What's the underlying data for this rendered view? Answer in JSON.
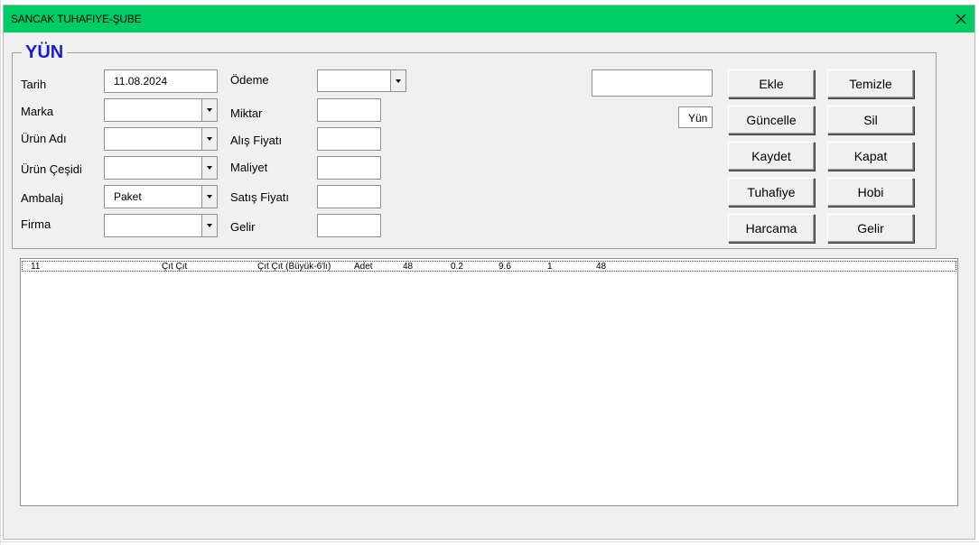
{
  "window": {
    "title": "SANCAK TUHAFIYE-ŞUBE"
  },
  "frame": {
    "caption": "YÜN"
  },
  "fields": {
    "tarih": {
      "label": "Tarih",
      "value": "11.08.2024"
    },
    "marka": {
      "label": "Marka",
      "value": ""
    },
    "urun_adi": {
      "label": "Ürün Adı",
      "value": ""
    },
    "urun_cesidi": {
      "label": "Ürün Çeşidi",
      "value": ""
    },
    "ambalaj": {
      "label": "Ambalaj",
      "value": "Paket"
    },
    "firma": {
      "label": "Firma",
      "value": ""
    },
    "odeme": {
      "label": "Ödeme",
      "value": ""
    },
    "miktar": {
      "label": "Miktar",
      "value": ""
    },
    "alis_fiyati": {
      "label": "Alış Fiyatı",
      "value": ""
    },
    "maliyet": {
      "label": "Maliyet",
      "value": ""
    },
    "satis_fiyati": {
      "label": "Satış Fiyatı",
      "value": ""
    },
    "gelir": {
      "label": "Gelir",
      "value": ""
    }
  },
  "search": {
    "value": ""
  },
  "category_badge": "Yün",
  "buttons": {
    "ekle": "Ekle",
    "temizle": "Temizle",
    "guncelle": "Güncelle",
    "sil": "Sil",
    "kaydet": "Kaydet",
    "kapat": "Kapat",
    "tuhafiye": "Tuhafiye",
    "hobi": "Hobi",
    "harcama": "Harcama",
    "gelir": "Gelir"
  },
  "list": {
    "rows": [
      [
        "11",
        "Çıt Çıt",
        "Çıt Çıt (Büyük-6'lı)",
        "Adet",
        "48",
        "0.2",
        "9.6",
        "1",
        "48"
      ]
    ]
  },
  "colors": {
    "titlebar": "#00cc66",
    "caption": "#1a1ad6"
  },
  "icons": {
    "close": "close-icon",
    "dropdown": "chevron-down-icon"
  }
}
